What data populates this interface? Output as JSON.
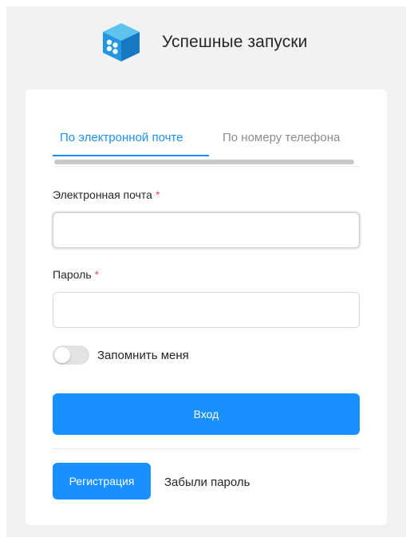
{
  "brand": {
    "title": "Успешные запуски",
    "logo_icon": "cube-logo-icon"
  },
  "tabs": [
    {
      "label": "По электронной почте",
      "active": true
    },
    {
      "label": "По номеру телефона",
      "active": false
    }
  ],
  "form": {
    "email": {
      "label": "Электронная почта",
      "required_mark": "*",
      "value": ""
    },
    "password": {
      "label": "Пароль",
      "required_mark": "*",
      "value": ""
    },
    "remember": {
      "label": "Запомнить меня",
      "checked": false
    }
  },
  "actions": {
    "login_label": "Вход",
    "register_label": "Регистрация",
    "forgot_label": "Забыли пароль"
  },
  "colors": {
    "primary": "#1890ff",
    "required": "#ff4d4f",
    "page_background": "#f2f2f2"
  }
}
